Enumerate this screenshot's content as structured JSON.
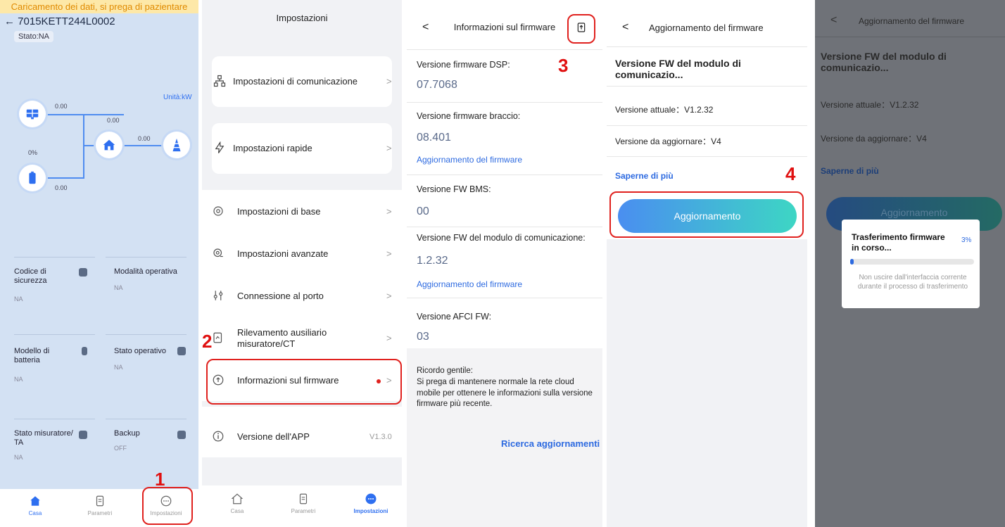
{
  "panel1": {
    "loading_text": "Caricamento dei dati, si prega di pazientare",
    "device_title": "7015KETT244L0002",
    "back_arrow": "←",
    "status": "Stato:NA",
    "unit": "Unità:kW",
    "values": {
      "pv": "0.00",
      "grid": "0.00",
      "home": "0.00",
      "battery_pct": "0%",
      "battery": "0.00"
    },
    "cards": [
      {
        "label": "Codice di sicurezza",
        "value": "NA"
      },
      {
        "label": "Modalità operativa",
        "value": "NA"
      },
      {
        "label": "Modello di batteria",
        "value": "NA"
      },
      {
        "label": "Stato operativo",
        "value": "NA"
      },
      {
        "label": "Stato misuratore/ TA",
        "value": "NA"
      },
      {
        "label": "Backup",
        "value": "OFF"
      }
    ],
    "tabs": [
      {
        "label": "Casa"
      },
      {
        "label": "Parametri"
      },
      {
        "label": "Impostazioni"
      }
    ],
    "step": "1"
  },
  "panel2": {
    "title": "Impostazioni",
    "items": [
      {
        "label": "Impostazioni di comunicazione"
      },
      {
        "label": "Impostazioni rapide"
      },
      {
        "label": "Impostazioni di base"
      },
      {
        "label": "Impostazioni avanzate"
      },
      {
        "label": "Connessione al porto"
      },
      {
        "label": "Rilevamento ausiliario misuratore/CT"
      },
      {
        "label": "Informazioni sul firmware"
      },
      {
        "label": "Versione dell'APP",
        "value": "V1.3.0"
      }
    ],
    "tabs": [
      {
        "label": "Casa"
      },
      {
        "label": "Parametri"
      },
      {
        "label": "Impostazioni"
      }
    ],
    "step": "2",
    "chevron": ">"
  },
  "panel3": {
    "title": "Informazioni sul firmware",
    "back": "<",
    "step": "3",
    "rows": [
      {
        "label": "Versione firmware DSP:",
        "value": "07.7068"
      },
      {
        "label": "Versione firmware braccio:",
        "value": "08.401",
        "link": "Aggiornamento del firmware"
      },
      {
        "label": "Versione FW BMS:",
        "value": "00"
      },
      {
        "label": "Versione FW del modulo di comunicazione:",
        "value": "1.2.32",
        "link": "Aggiornamento del firmware"
      },
      {
        "label": "Versione AFCI FW:",
        "value": "03"
      }
    ],
    "note_title": "Ricordo gentile:",
    "note_body": "Si prega di mantenere normale la rete cloud mobile per ottenere le informazioni sulla versione firmware più recente.",
    "search_link": "Ricerca aggiornamenti"
  },
  "panel4": {
    "title": "Aggiornamento del firmware",
    "back": "<",
    "heading": "Versione FW del modulo di comunicazio...",
    "current": "Versione attuale：V1.2.32",
    "target": "Versione da aggiornare：V4",
    "more": "Saperne di più",
    "button": "Aggiornamento",
    "step": "4"
  },
  "panel5": {
    "title": "Aggiornamento del firmware",
    "back": "<",
    "heading": "Versione FW del modulo di comunicazio...",
    "current": "Versione attuale：V1.2.32",
    "target": "Versione da aggiornare：V4",
    "more": "Saperne di più",
    "button": "Aggiornamento",
    "dialog": {
      "title": "Trasferimento firmware in corso...",
      "percent": "3%",
      "progress": 0.03,
      "message": "Non uscire dall'interfaccia corrente durante il processo di trasferimento"
    }
  },
  "colors": {
    "accent": "#2d6ae0",
    "highlight": "#e0211e",
    "button_start": "#4a8ef0",
    "button_end": "#3dd6c4"
  }
}
